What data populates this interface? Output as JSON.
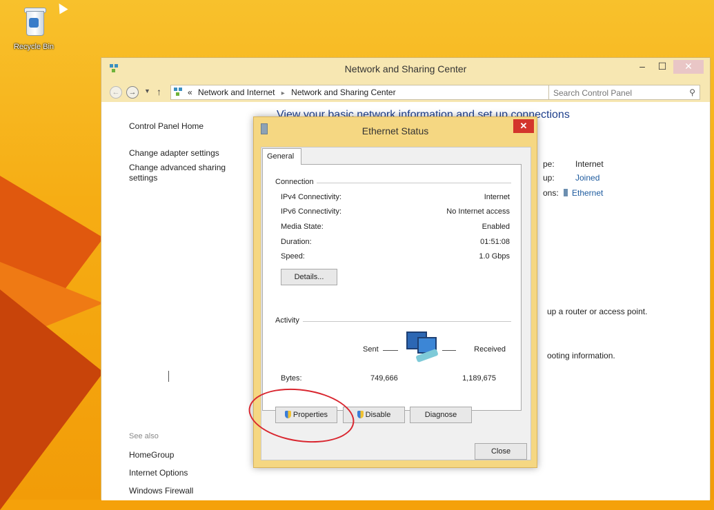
{
  "desktop": {
    "recycle_bin_label": "Recycle Bin"
  },
  "main_window": {
    "title": "Network and Sharing Center",
    "controls": {
      "minimize": "–",
      "maximize": "☐",
      "close": "✕"
    },
    "address": {
      "crumbs": [
        "Network and Internet",
        "Network and Sharing Center"
      ],
      "prefix": "«",
      "search_placeholder": "Search Control Panel"
    },
    "left_pane": {
      "home": "Control Panel Home",
      "adapter": "Change adapter settings",
      "sharing": "Change advanced sharing settings",
      "see_also": "See also",
      "homegroup": "HomeGroup",
      "internet_options": "Internet Options",
      "firewall": "Windows Firewall"
    },
    "heading": "View your basic network information and set up connections",
    "network_info": {
      "access_type_label": "pe:",
      "access_type_value": "Internet",
      "homegroup_label": "up:",
      "homegroup_value": "Joined",
      "connections_label": "ons:",
      "connections_value": "Ethernet"
    },
    "partial_1": "up a router or access point.",
    "partial_2": "ooting information."
  },
  "dialog": {
    "title": "Ethernet Status",
    "close_glyph": "✕",
    "tab": "General",
    "connection_group": "Connection",
    "rows": [
      {
        "label": "IPv4 Connectivity:",
        "value": "Internet"
      },
      {
        "label": "IPv6 Connectivity:",
        "value": "No Internet access"
      },
      {
        "label": "Media State:",
        "value": "Enabled"
      },
      {
        "label": "Duration:",
        "value": "01:51:08"
      },
      {
        "label": "Speed:",
        "value": "1.0 Gbps"
      }
    ],
    "details_button": "Details...",
    "activity_group": "Activity",
    "sent_label": "Sent",
    "received_label": "Received",
    "bytes_label": "Bytes:",
    "bytes_sent": "749,666",
    "bytes_received": "1,189,675",
    "properties_button": "Properties",
    "disable_button": "Disable",
    "diagnose_button": "Diagnose",
    "close_button": "Close"
  },
  "colors": {
    "desktop": "#f6ad14",
    "window_frame": "#f7e7b2",
    "dialog_frame": "#f5d782",
    "dialog_close": "#d3352c",
    "heading": "#1e3f8c",
    "link": "#1c5a9e",
    "annotation": "#d9262f"
  }
}
